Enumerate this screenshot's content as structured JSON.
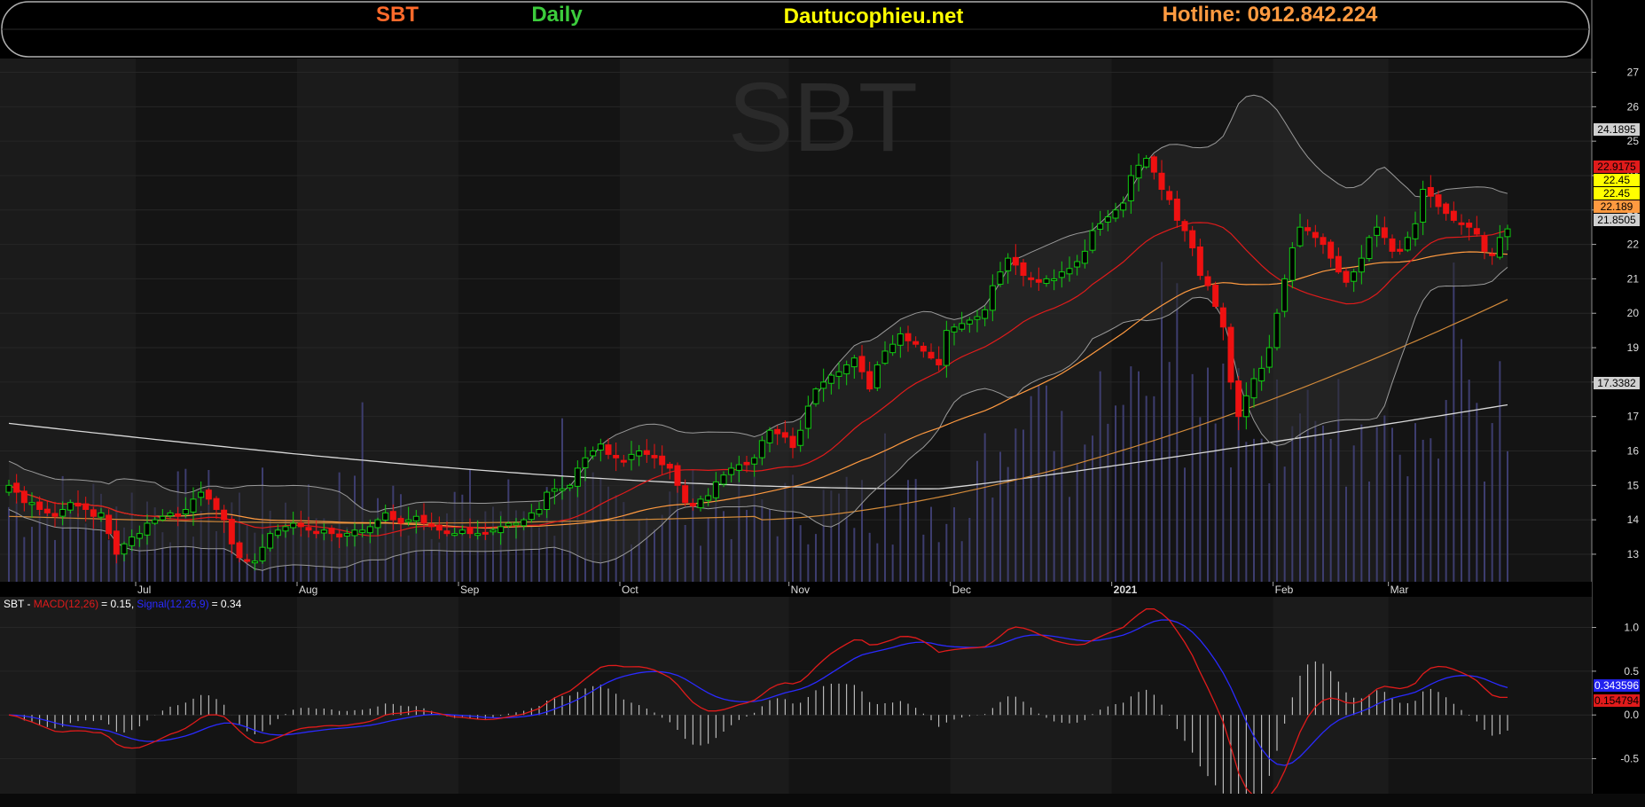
{
  "header": {
    "ticker": "SBT",
    "period": "Daily",
    "site": "Dautucophieu.net",
    "hotline": "Hotline: 0912.842.224",
    "colors": {
      "ticker": "#ff6a2b",
      "period": "#3ccc3c",
      "site": "#ffff00",
      "hotline": "#ff9a40"
    }
  },
  "chart_data": [
    {
      "type": "candlestick",
      "title": "SBT",
      "xlabel": "",
      "ylabel": "",
      "ylim": [
        12.2,
        27.4
      ],
      "y_ticks": [
        13,
        14,
        15,
        16,
        17,
        18,
        19,
        20,
        21,
        22,
        23,
        24,
        25,
        26,
        27
      ],
      "x_month_labels": [
        {
          "label": "Jul",
          "index": 17
        },
        {
          "label": "Aug",
          "index": 38
        },
        {
          "label": "Sep",
          "index": 59
        },
        {
          "label": "Oct",
          "index": 80
        },
        {
          "label": "Nov",
          "index": 102
        },
        {
          "label": "Dec",
          "index": 123
        },
        {
          "label": "2021",
          "index": 144
        },
        {
          "label": "Feb",
          "index": 165
        },
        {
          "label": "Mar",
          "index": 180
        }
      ],
      "closes": [
        15.0,
        14.8,
        14.5,
        14.5,
        14.3,
        14.2,
        14.1,
        14.3,
        14.5,
        14.4,
        14.3,
        14.1,
        14.2,
        13.6,
        13.0,
        13.3,
        13.5,
        13.6,
        13.9,
        14.0,
        14.1,
        14.2,
        14.1,
        14.3,
        14.6,
        14.8,
        14.6,
        14.3,
        14.0,
        13.3,
        12.9,
        12.8,
        12.8,
        13.2,
        13.6,
        13.7,
        13.8,
        13.9,
        13.8,
        13.7,
        13.6,
        13.7,
        13.6,
        13.5,
        13.6,
        13.7,
        13.7,
        13.8,
        14.0,
        14.2,
        14.0,
        13.9,
        14.0,
        14.1,
        13.9,
        13.8,
        13.7,
        13.6,
        13.6,
        13.7,
        13.6,
        13.6,
        13.6,
        13.7,
        13.8,
        13.9,
        13.9,
        14.0,
        14.2,
        14.3,
        14.8,
        14.9,
        14.9,
        15.0,
        15.5,
        15.8,
        16.0,
        16.2,
        15.9,
        15.8,
        15.7,
        15.9,
        16.0,
        15.9,
        15.8,
        15.6,
        15.5,
        15.0,
        14.5,
        14.4,
        14.6,
        14.7,
        15.1,
        15.3,
        15.5,
        15.6,
        15.6,
        15.8,
        16.3,
        16.6,
        16.5,
        16.4,
        16.1,
        16.6,
        17.3,
        17.8,
        18.0,
        18.2,
        18.3,
        18.5,
        18.7,
        18.3,
        17.8,
        18.5,
        18.9,
        19.1,
        19.4,
        19.2,
        19.1,
        18.9,
        18.7,
        18.5,
        19.5,
        19.6,
        19.7,
        19.8,
        19.9,
        20.1,
        20.8,
        21.2,
        21.6,
        21.4,
        21.1,
        21.0,
        20.9,
        21.0,
        21.0,
        21.2,
        21.3,
        21.5,
        21.8,
        22.4,
        22.6,
        22.8,
        23.0,
        23.2,
        24.0,
        24.3,
        24.5,
        24.1,
        23.6,
        23.3,
        22.7,
        22.4,
        21.9,
        21.1,
        20.8,
        20.2,
        19.6,
        18.0,
        17.0,
        17.6,
        18.1,
        18.4,
        19.0,
        20.0,
        21.0,
        21.9,
        22.5,
        22.4,
        22.2,
        22.0,
        21.6,
        21.2,
        20.9,
        21.2,
        21.6,
        22.2,
        22.5,
        22.2,
        21.8,
        21.8,
        22.2,
        22.6,
        23.6,
        23.4,
        23.1,
        22.9,
        22.7,
        22.6,
        22.5,
        22.3,
        21.8,
        21.7,
        22.2,
        22.45
      ],
      "indicator_lines": [
        {
          "name": "MA200",
          "color": "#d8d8d8",
          "last": 17.3382
        },
        {
          "name": "MA50",
          "color": "#ff9a40",
          "last": 22.189
        },
        {
          "name": "MA20",
          "color": "#e01b1b",
          "last": 22.9175
        },
        {
          "name": "Bollinger upper",
          "color": "#9a9a9a",
          "last": 24.1895
        },
        {
          "name": "Bollinger lower",
          "color": "#9a9a9a",
          "last": 21.8505
        },
        {
          "name": "MA100",
          "color": "#d28a3a",
          "last": 20.4
        }
      ],
      "price_tags": [
        {
          "value": "24.1895",
          "bg": "#d0d0d0",
          "fg": "#000000"
        },
        {
          "value": "22.9175",
          "bg": "#e01b1b",
          "fg": "#000000"
        },
        {
          "value": "22.45",
          "bg": "#ffff00",
          "fg": "#000000"
        },
        {
          "value": "22.45",
          "bg": "#ffff00",
          "fg": "#000000"
        },
        {
          "value": "22.189",
          "bg": "#ff9a40",
          "fg": "#000000"
        },
        {
          "value": "21.8505",
          "bg": "#d0d0d0",
          "fg": "#000000"
        },
        {
          "value": "17.3382",
          "bg": "#d0d0d0",
          "fg": "#000000"
        }
      ]
    },
    {
      "type": "line",
      "title": "SBT - MACD(12,26) = 0.15, Signal(12,26,9) = 0.34",
      "ylim": [
        -0.9,
        1.35
      ],
      "y_ticks": [
        -0.5,
        0.0,
        0.5,
        1.0
      ],
      "series": [
        {
          "name": "MACD(12,26)",
          "color": "#e01b1b",
          "last": 0.154794
        },
        {
          "name": "Signal(12,26,9)",
          "color": "#2a2aff",
          "last": 0.343596
        }
      ],
      "price_tags": [
        {
          "value": "0.343596",
          "bg": "#2222ee",
          "fg": "#ffffff"
        },
        {
          "value": "0.154794",
          "bg": "#e01b1b",
          "fg": "#000000"
        }
      ]
    }
  ],
  "macd_legend": {
    "ticker": "SBT",
    "macd_label": "MACD(12,26)",
    "macd_value": "= 0.15,",
    "signal_label": "Signal(12,26,9)",
    "signal_value": "= 0.34"
  }
}
